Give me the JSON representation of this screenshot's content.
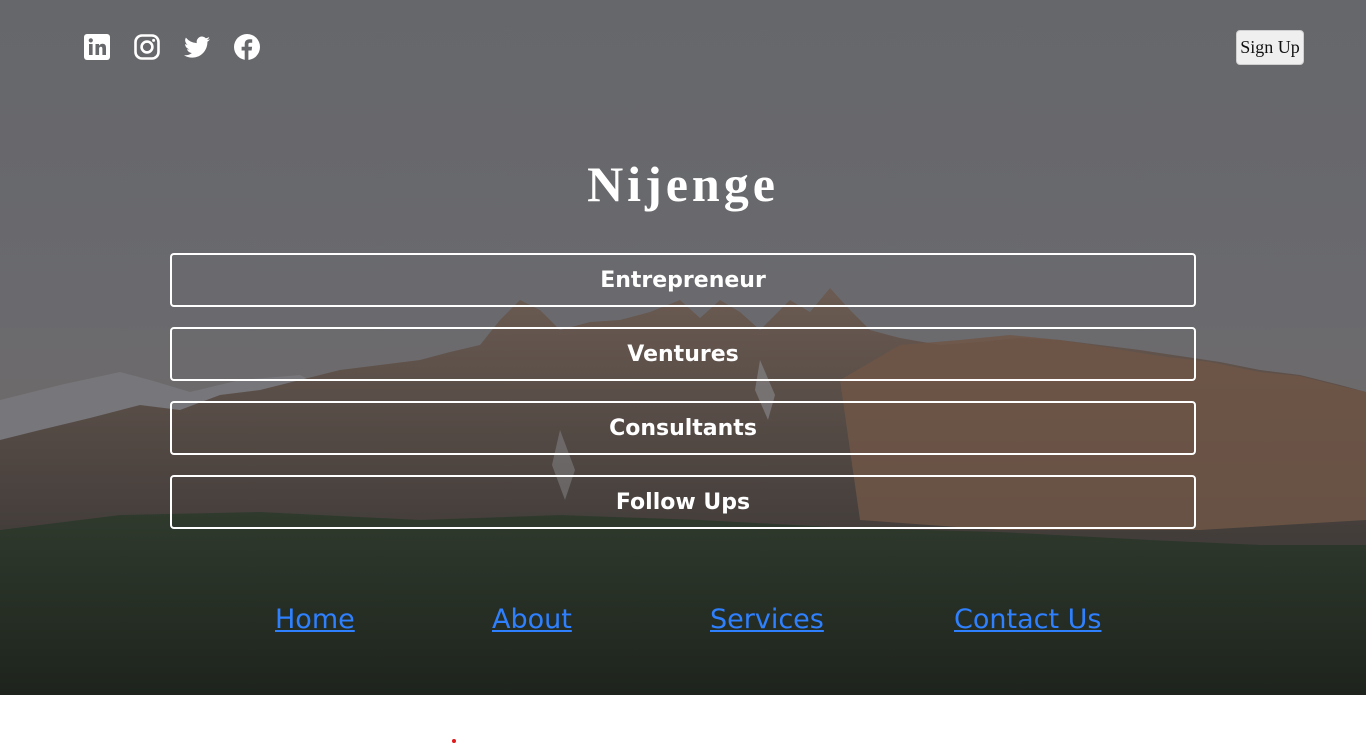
{
  "header": {
    "social_icons": [
      {
        "name": "linkedin-icon"
      },
      {
        "name": "instagram-icon"
      },
      {
        "name": "twitter-icon"
      },
      {
        "name": "facebook-icon"
      }
    ],
    "signup_label": "Sign Up"
  },
  "brand": {
    "title": "Nijenge"
  },
  "menu": {
    "items": [
      {
        "label": "Entrepreneur"
      },
      {
        "label": "Ventures"
      },
      {
        "label": "Consultants"
      },
      {
        "label": "Follow Ups"
      }
    ]
  },
  "nav": {
    "links": [
      {
        "label": "Home"
      },
      {
        "label": "About"
      },
      {
        "label": "Services"
      },
      {
        "label": "Contact Us"
      }
    ]
  },
  "colors": {
    "overlay": "#67686c",
    "link": "#2f80ff",
    "button_border": "#ffffff",
    "dot": "#e0191c"
  }
}
